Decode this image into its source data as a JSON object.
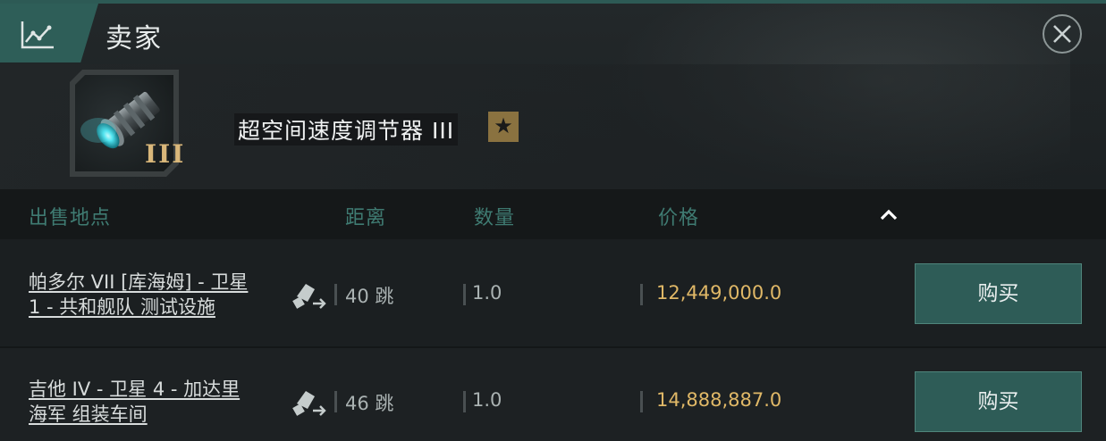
{
  "header": {
    "title": "卖家",
    "icon": "chart-line-icon",
    "close_icon": "close-icon"
  },
  "item": {
    "name": "超空间速度调节器 III",
    "tier_label": "III",
    "badge_icon": "star-icon",
    "badge_glyph": "★"
  },
  "table": {
    "columns": [
      "出售地点",
      "距离",
      "数量",
      "价格"
    ],
    "sort_icon": "chevron-up-icon",
    "rows": [
      {
        "location_line1": "帕多尔 VII [库海姆] - 卫星",
        "location_line2": "1 - 共和舰队 测试设施",
        "distance": "40 跳",
        "quantity": "1.0",
        "price": "12,449,000.0",
        "buy_label": "购买"
      },
      {
        "location_line1": "吉他 IV - 卫星 4 - 加达里",
        "location_line2": "海军 组装车间",
        "distance": "46 跳",
        "quantity": "1.0",
        "price": "14,888,887.0",
        "buy_label": "购买"
      }
    ]
  },
  "colors": {
    "accent": "#2e5e58",
    "price": "#e0b867",
    "column_header": "#3f7b72"
  }
}
